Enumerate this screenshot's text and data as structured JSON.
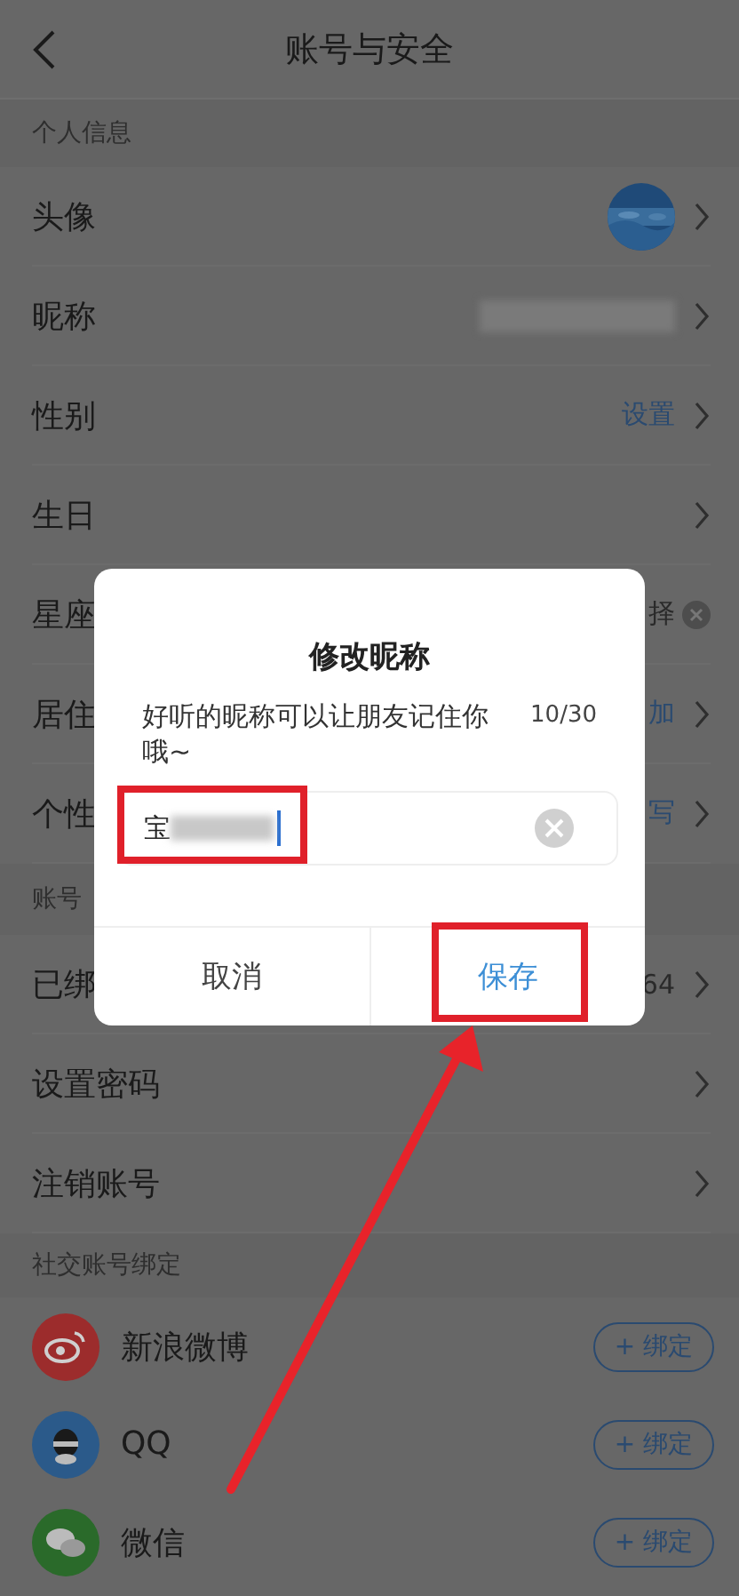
{
  "header": {
    "title": "账号与安全"
  },
  "sections": [
    {
      "title": "个人信息",
      "rows": [
        {
          "label": "头像",
          "kind": "avatar"
        },
        {
          "label": "昵称",
          "kind": "redacted"
        },
        {
          "label": "性别",
          "kind": "link",
          "value": "设置"
        },
        {
          "label": "生日",
          "kind": "plain"
        },
        {
          "label": "星座",
          "kind": "clear",
          "value": "择"
        },
        {
          "label": "居住",
          "kind": "link",
          "value": "加"
        },
        {
          "label": "个性",
          "kind": "link",
          "value": "写"
        }
      ]
    },
    {
      "title": "账号",
      "rows": [
        {
          "label": "已绑",
          "kind": "text",
          "value": "64"
        },
        {
          "label": "设置密码",
          "kind": "plain"
        },
        {
          "label": "注销账号",
          "kind": "plain"
        }
      ]
    }
  ],
  "social": {
    "title": "社交账号绑定",
    "accounts": [
      {
        "name": "新浪微博",
        "kind": "weibo",
        "color": "#9c2c2c",
        "button": "+ 绑定"
      },
      {
        "name": "QQ",
        "kind": "qq",
        "color": "#2b5a8a",
        "button": "+ 绑定"
      },
      {
        "name": "微信",
        "kind": "wechat",
        "color": "#2a6a2a",
        "button": "+ 绑定"
      }
    ]
  },
  "dialog": {
    "title": "修改昵称",
    "hint": "好听的昵称可以让朋友记住你哦~",
    "counter": "10/30",
    "field": {
      "value": "宝",
      "highlighted": true
    },
    "buttons": [
      {
        "label": "取消",
        "primary": false,
        "highlighted": false
      },
      {
        "label": "保存",
        "primary": true,
        "highlighted": true
      }
    ]
  }
}
